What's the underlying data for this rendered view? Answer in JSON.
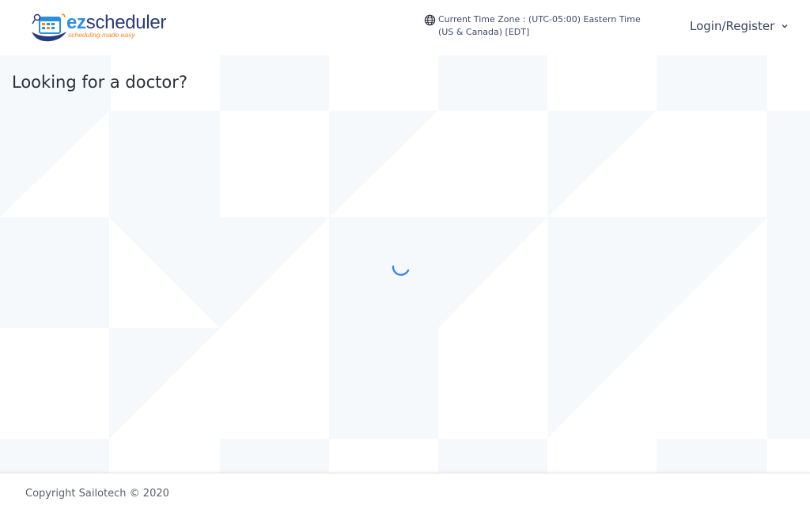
{
  "header": {
    "logo": {
      "brand_ez": "ez",
      "brand_rest": "scheduler",
      "tagline": "scheduling made easy"
    },
    "timezone": {
      "icon": "globe-icon",
      "text": "Current Time Zone : (UTC-05:00) Eastern Time (US & Canada) [EDT]"
    },
    "login": {
      "label": "Login/Register",
      "icon": "chevron-down-icon"
    }
  },
  "main": {
    "title": "Looking for a doctor?",
    "loading": true
  },
  "footer": {
    "copyright": "Copyright Sailotech © 2020"
  },
  "colors": {
    "brand_blue": "#2b8fe0",
    "brand_navy": "#2a3a7c",
    "brand_orange": "#f08a24",
    "spinner": "#3b82f6",
    "pattern": "#f5f9fc"
  }
}
